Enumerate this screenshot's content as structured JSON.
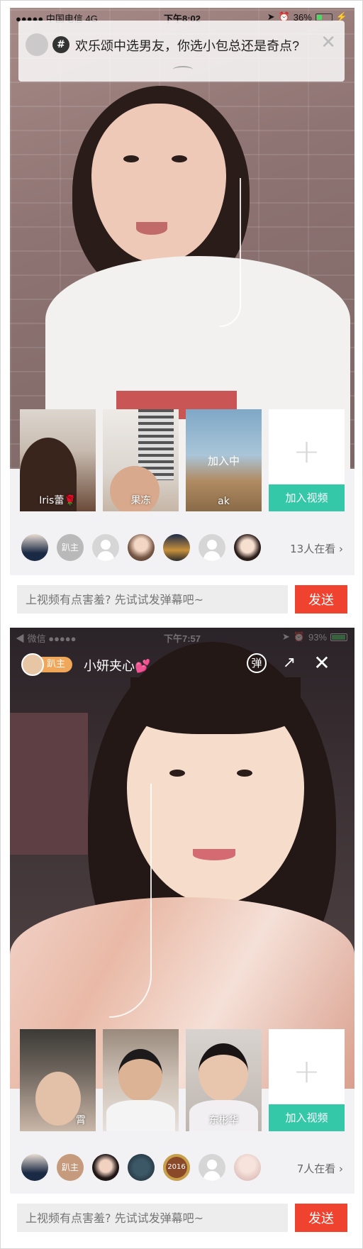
{
  "screen1": {
    "status_bar": {
      "carrier": "●●●●● 中国电信  4G",
      "time": "下午8:02",
      "battery": "36%",
      "battery_level": 0.36
    },
    "topic": {
      "hash_icon": "#",
      "title": "欢乐颂中选男友，你选小包总还是奇点?"
    },
    "tiles": [
      {
        "label": "Iris蕾🌹",
        "center": ""
      },
      {
        "label": "果冻",
        "center": ""
      },
      {
        "label": "ak",
        "center": "加入中"
      }
    ],
    "add_tile": {
      "join_label": "加入视频"
    },
    "viewers": {
      "host_badge": "趴主",
      "count_text": "13人在看 ›"
    },
    "input": {
      "placeholder": "上视频有点害羞? 先试试发弹幕吧~",
      "send_label": "发送"
    }
  },
  "screen2": {
    "status_bar": {
      "carrier": "◀ 微信  ●●●●●",
      "time": "下午7:57",
      "battery": "93%",
      "battery_level": 0.93
    },
    "host": {
      "badge": "趴主",
      "name": "小妍夹心💕",
      "danmu_label": "弹"
    },
    "tiles": [
      {
        "label": "霄"
      },
      {
        "label": ""
      },
      {
        "label": "东彬华"
      }
    ],
    "add_tile": {
      "join_label": "加入视频"
    },
    "viewers": {
      "host_badge": "趴主",
      "year_badge": "2016",
      "count_text": "7人在看 ›"
    },
    "input": {
      "placeholder": "上视频有点害羞? 先试试发弹幕吧~",
      "send_label": "发送"
    }
  },
  "colors": {
    "join_button": "#35c8a8",
    "send_button": "#f0432f",
    "host_badge": "#f0a75a"
  }
}
